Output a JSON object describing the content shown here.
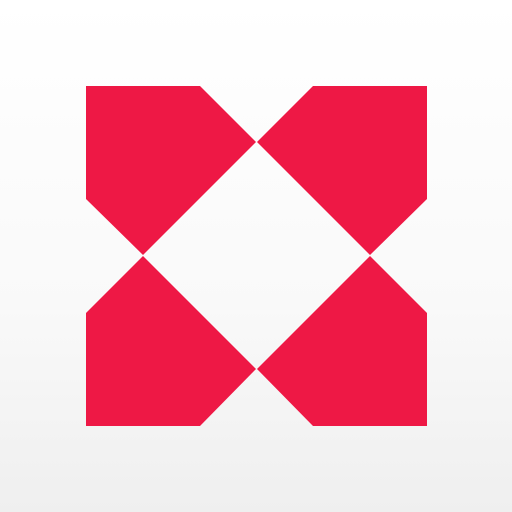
{
  "icon": {
    "name": "app-logo-icon",
    "shape": "four-square-pinwheel-mark",
    "colors": {
      "mark": "#ee1845",
      "background_top": "#ffffff",
      "background_bottom": "#efefef"
    }
  }
}
